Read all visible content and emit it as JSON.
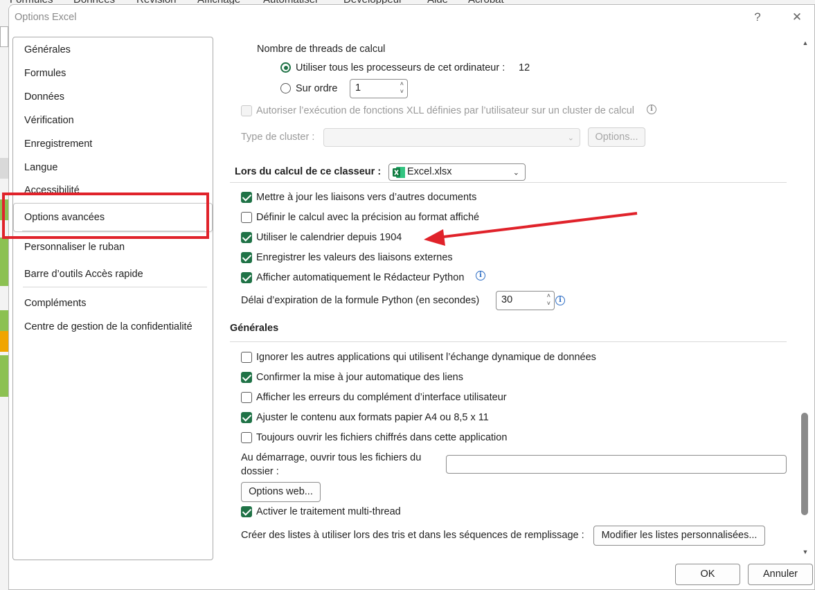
{
  "background": {
    "menu_items": [
      "Formules",
      "Données",
      "Révision",
      "Affichage",
      "Automatiser",
      "Développeur",
      "Aide",
      "Acrobat"
    ]
  },
  "dialog": {
    "title": "Options Excel",
    "help_symbol": "?",
    "close_symbol": "✕"
  },
  "nav": {
    "items": [
      "Générales",
      "Formules",
      "Données",
      "Vérification",
      "Enregistrement",
      "Langue",
      "Accessibilité",
      "Options avancées",
      "Personnaliser le ruban",
      "Barre d’outils Accès rapide",
      "Compléments",
      "Centre de gestion de la confidentialité"
    ],
    "selected": "Options avancées"
  },
  "threads": {
    "label": "Nombre de threads de calcul",
    "use_all_label": "Utiliser tous les processeurs de cet ordinateur :",
    "processor_count": "12",
    "manual_label": "Sur ordre",
    "manual_value": "1",
    "xll_label": "Autoriser l’exécution de fonctions XLL définies par l’utilisateur sur un cluster de calcul",
    "cluster_type_label": "Type de cluster :",
    "options_button": "Options..."
  },
  "workbook_calc": {
    "title": "Lors du calcul de ce classeur :",
    "selected_workbook": "Excel.xlsx",
    "options": [
      {
        "label": "Mettre à jour les liaisons vers d’autres documents",
        "checked": true
      },
      {
        "label": "Définir le calcul avec la précision au format affiché",
        "checked": false
      },
      {
        "label": "Utiliser le calendrier depuis 1904",
        "checked": true
      },
      {
        "label": "Enregistrer les valeurs des liaisons externes",
        "checked": true
      },
      {
        "label": "Afficher automatiquement le Rédacteur Python",
        "checked": true
      }
    ],
    "python_timeout_label": "Délai d’expiration de la formule Python (en secondes)",
    "python_timeout_value": "30"
  },
  "general": {
    "title": "Générales",
    "options": [
      {
        "label": "Ignorer les autres applications qui utilisent l’échange dynamique de données",
        "checked": false
      },
      {
        "label": "Confirmer la mise à jour automatique des liens",
        "checked": true
      },
      {
        "label": "Afficher les erreurs du complément d’interface utilisateur",
        "checked": false
      },
      {
        "label": "Ajuster le contenu aux formats papier A4 ou 8,5 x 11",
        "checked": true
      },
      {
        "label": "Toujours ouvrir les fichiers chiffrés dans cette application",
        "checked": false
      }
    ],
    "startup_label_line1": "Au démarrage, ouvrir tous les fichiers du",
    "startup_label_line2": "dossier :",
    "startup_value": "",
    "web_options_button": "Options web...",
    "multithread_label": "Activer le traitement multi-thread",
    "multithread_checked": true,
    "custom_lists_label": "Créer des listes à utiliser lors des tris et dans les séquences de remplissage :",
    "custom_lists_button": "Modifier les listes personnalisées..."
  },
  "footer": {
    "ok": "OK",
    "cancel": "Annuler"
  },
  "colors": {
    "accent_green": "#1f7246",
    "highlight_red": "#e0222a",
    "info_blue": "#2b6cc4"
  }
}
